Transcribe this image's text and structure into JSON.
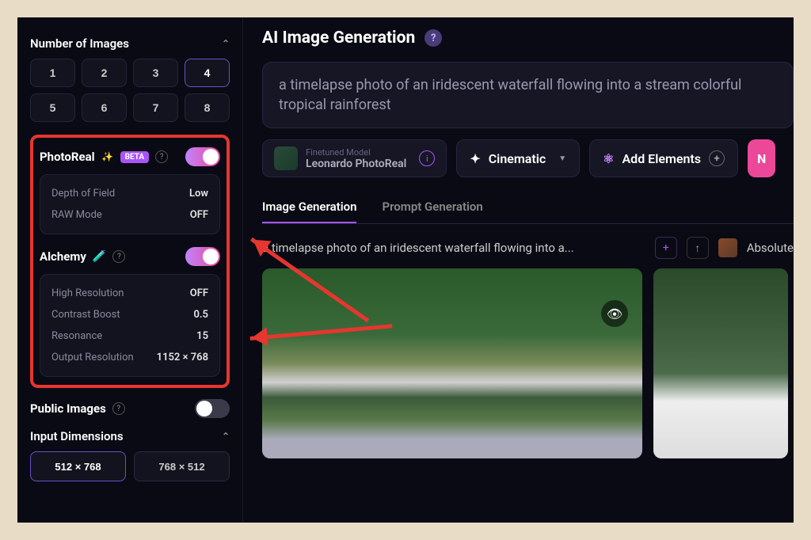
{
  "sidebar": {
    "numImages": {
      "title": "Number of Images",
      "buttons": [
        "1",
        "2",
        "3",
        "4",
        "5",
        "6",
        "7",
        "8"
      ],
      "active": "4"
    },
    "photoReal": {
      "title": "PhotoReal",
      "beta": "BETA",
      "settings": [
        {
          "label": "Depth of Field",
          "value": "Low"
        },
        {
          "label": "RAW Mode",
          "value": "OFF"
        }
      ]
    },
    "alchemy": {
      "title": "Alchemy",
      "settings": [
        {
          "label": "High Resolution",
          "value": "OFF"
        },
        {
          "label": "Contrast Boost",
          "value": "0.5"
        },
        {
          "label": "Resonance",
          "value": "15"
        },
        {
          "label": "Output Resolution",
          "value": "1152 × 768"
        }
      ]
    },
    "publicImages": {
      "title": "Public Images"
    },
    "inputDimensions": {
      "title": "Input Dimensions",
      "options": [
        "512 × 768",
        "768 × 512"
      ],
      "active": "512 × 768"
    }
  },
  "main": {
    "title": "AI Image Generation",
    "prompt": "a timelapse photo of an iridescent waterfall flowing into a stream colorful tropical rainforest",
    "model": {
      "label": "Finetuned Model",
      "name": "Leonardo PhotoReal"
    },
    "style": "Cinematic",
    "addElements": "Add Elements",
    "newBtn": "N",
    "tabs": [
      "Image Generation",
      "Prompt Generation"
    ],
    "activeTab": "Image Generation",
    "resultTitle": "a timelapse photo of an iridescent waterfall flowing into a...",
    "resultModel": "Absolute"
  }
}
